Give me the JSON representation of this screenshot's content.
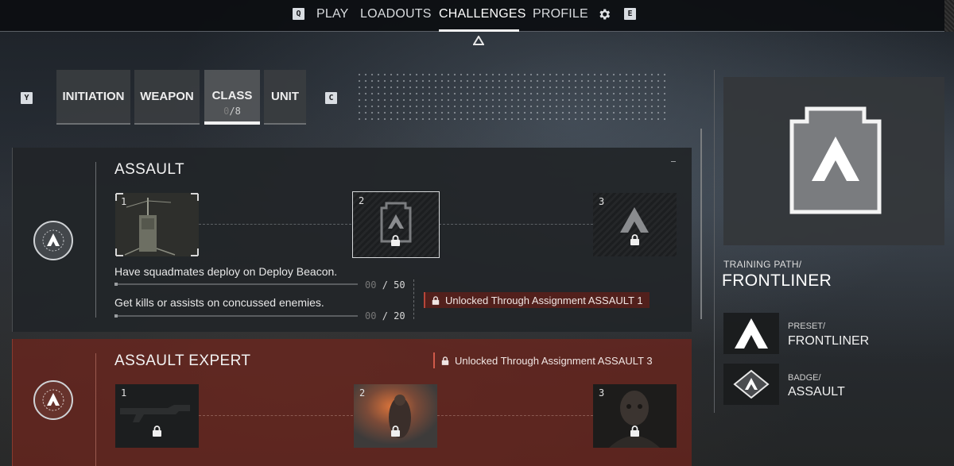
{
  "nav": {
    "left_key": "Q",
    "right_key": "E",
    "tabs": [
      "PLAY",
      "LOADOUTS",
      "CHALLENGES",
      "PROFILE"
    ],
    "active_tab": "CHALLENGES"
  },
  "categories": {
    "left_key": "Y",
    "right_key": "C",
    "tabs": [
      "INITIATION",
      "WEAPON",
      "CLASS",
      "UNIT"
    ],
    "active": "CLASS",
    "class_count_done": "0",
    "class_count_total": "/8"
  },
  "assault": {
    "title": "ASSAULT",
    "tile_numbers": [
      "1",
      "2",
      "3"
    ],
    "objectives": [
      {
        "text": "Have squadmates deploy on Deploy Beacon.",
        "current": "00",
        "total": "/ 50"
      },
      {
        "text": "Get kills or assists on concussed enemies.",
        "current": "00",
        "total": "/ 20"
      }
    ],
    "unlock_text": "Unlocked Through Assignment ASSAULT 1"
  },
  "assault_expert": {
    "title": "ASSAULT EXPERT",
    "tile_numbers": [
      "1",
      "2",
      "3"
    ],
    "unlock_text": "Unlocked Through Assignment ASSAULT 3"
  },
  "right_panel": {
    "path_label": "TRAINING PATH/",
    "path_name": "FRONTLINER",
    "items": [
      {
        "label": "PRESET/",
        "title": "FRONTLINER",
        "icon": "frontliner-chevron-icon"
      },
      {
        "label": "BADGE/",
        "title": "ASSAULT",
        "icon": "assault-badge-icon"
      }
    ]
  },
  "colors": {
    "accent_red": "#7a2a20",
    "tag_red": "#b8463a",
    "panel_dark": "#222528"
  }
}
